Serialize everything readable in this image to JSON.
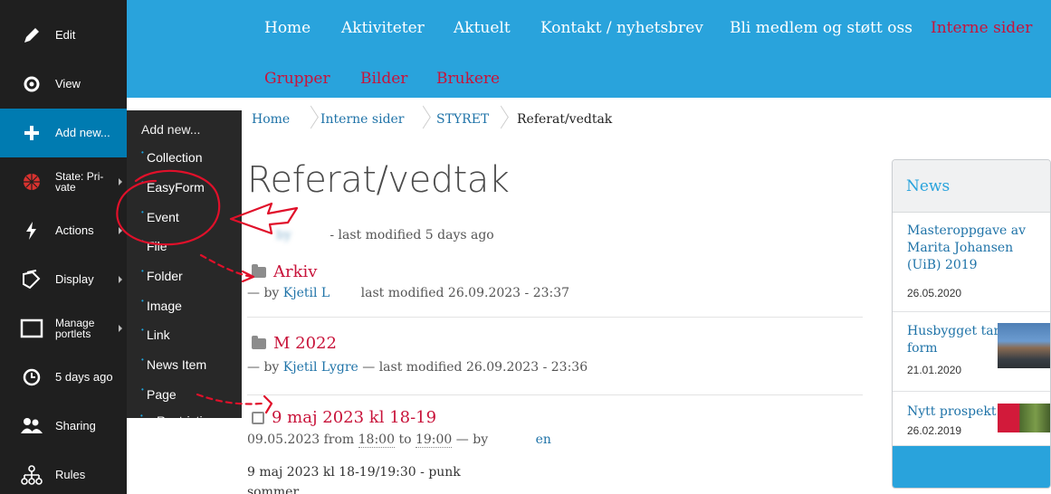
{
  "toolbar": {
    "items": [
      {
        "label": "Edit",
        "icon": "pencil-icon"
      },
      {
        "label": "View",
        "icon": "eye-icon"
      },
      {
        "label": "Add new...",
        "icon": "plus-icon"
      },
      {
        "label_1": "State: Pri-",
        "label_2": "vate",
        "icon": "state-icon"
      },
      {
        "label": "Actions",
        "icon": "lightning-icon"
      },
      {
        "label": "Display",
        "icon": "display-icon"
      },
      {
        "label_1": "Manage",
        "label_2": "portlets",
        "icon": "portlets-icon"
      },
      {
        "label": "5 days ago",
        "icon": "clock-icon"
      },
      {
        "label": "Sharing",
        "icon": "users-icon"
      },
      {
        "label": "Rules",
        "icon": "rules-icon"
      }
    ]
  },
  "submenu": {
    "title": "Add new...",
    "items": [
      "Collection",
      "EasyForm",
      "Event",
      "File",
      "Folder",
      "Image",
      "Link",
      "News Item",
      "Page",
      "Restrictions..."
    ]
  },
  "topnav": {
    "items": [
      "Home",
      "Aktiviteter",
      "Aktuelt",
      "Kontakt / nyhetsbrev",
      "Bli medlem og støtt oss",
      "Interne sider"
    ],
    "items_row2": [
      "Grupper",
      "Bilder",
      "Brukere"
    ]
  },
  "breadcrumbs": [
    "Home",
    "Interne sider",
    "STYRET",
    "Referat/vedtak"
  ],
  "main": {
    "title": "Referat/vedtak",
    "doc_meta": "- last modified 5 days ago",
    "doc_meta_author": "by",
    "listing": [
      {
        "title": "Arkiv",
        "by": "— by",
        "author": "Kjetil L",
        "meta": "last modified 26.09.2023 - 23:37"
      },
      {
        "title": "M 2022",
        "by": "— by",
        "author": "Kjetil Lygre",
        "meta": "— last modified 26.09.2023 - 23:36"
      },
      {
        "title": "9 maj 2023 kl 18-19",
        "date": "09.05.2023 from",
        "from": "18:00",
        "to_word": "to",
        "to": "19:00",
        "by": "— by",
        "author": "en"
      }
    ],
    "snippet_1": "9 maj 2023 kl 18-19/19:30 - punk",
    "snippet_2": "sommer"
  },
  "news": {
    "header": "News",
    "items": [
      {
        "title": "Masteroppgave av Marita Johansen (UiB) 2019",
        "date": "26.05.2020"
      },
      {
        "title": "Husbygget tar form",
        "date": "21.01.2020"
      },
      {
        "title": "Nytt prospekt",
        "date": "26.02.2019"
      }
    ]
  },
  "colors": {
    "brand_blue": "#29a3dc",
    "toolbar_dark": "#1f1f1f",
    "toolbar_active": "#007bb1",
    "link_red": "#c8133a",
    "annotation_red": "#e0102a"
  }
}
